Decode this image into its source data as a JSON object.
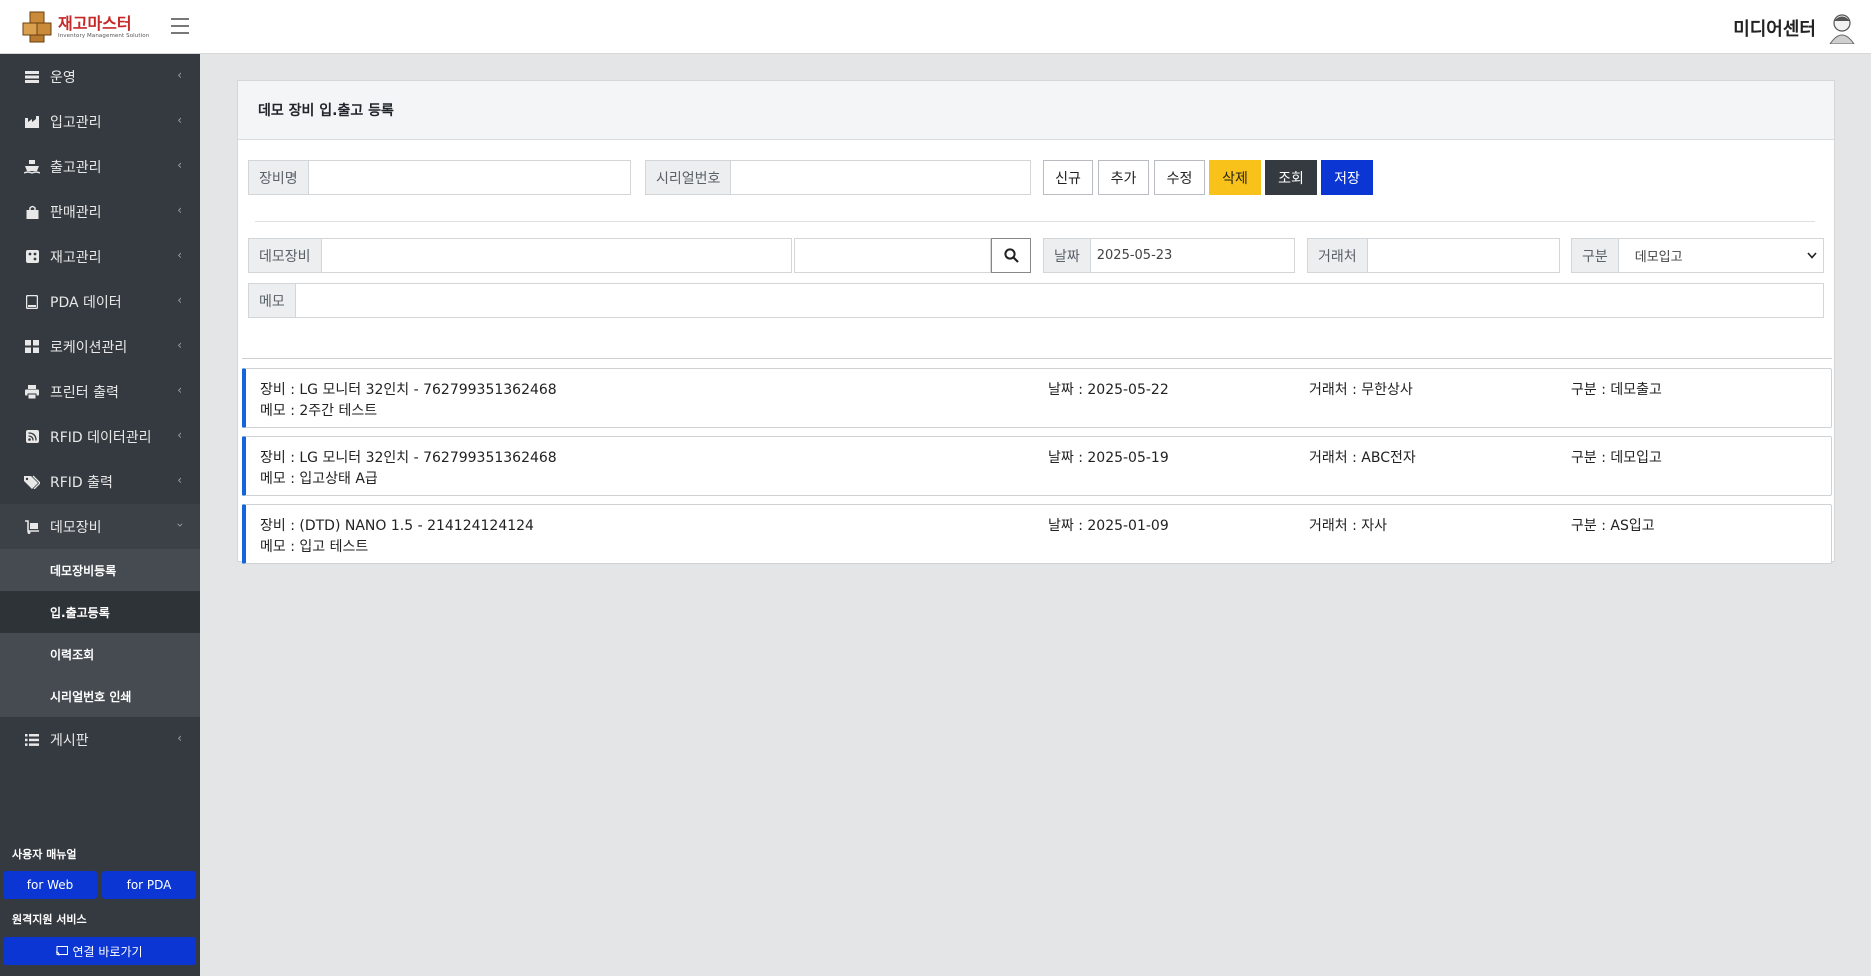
{
  "header": {
    "logo_name": "재고마스터",
    "logo_sub": "Inventory Management Solution",
    "user_name": "미디어센터"
  },
  "sidebar": {
    "items": [
      {
        "label": "운영",
        "icon": "list-icon"
      },
      {
        "label": "입고관리",
        "icon": "factory-icon"
      },
      {
        "label": "출고관리",
        "icon": "ship-icon"
      },
      {
        "label": "판매관리",
        "icon": "shopping-bag-icon"
      },
      {
        "label": "재고관리",
        "icon": "box-icon"
      },
      {
        "label": "PDA 데이터",
        "icon": "tablet-icon"
      },
      {
        "label": "로케이션관리",
        "icon": "grid-icon"
      },
      {
        "label": "프린터 출력",
        "icon": "printer-icon"
      },
      {
        "label": "RFID 데이터관리",
        "icon": "rss-icon"
      },
      {
        "label": "RFID 출력",
        "icon": "tags-icon"
      },
      {
        "label": "데모장비",
        "icon": "dolly-icon"
      }
    ],
    "sub_items": [
      "데모장비등록",
      "입.출고등록",
      "이력조회",
      "시리얼번호 인쇄"
    ],
    "board": {
      "label": "게시판",
      "icon": "list-ul-icon"
    },
    "manual_label": "사용자 매뉴얼",
    "manual_web": "for Web",
    "manual_pda": "for PDA",
    "remote_label": "원격지원 서비스",
    "remote_button": "연결 바로가기"
  },
  "card": {
    "title": "데모 장비 입.출고 등록",
    "equipment_name_label": "장비명",
    "serial_label": "시리얼번호",
    "buttons": {
      "new": "신규",
      "add": "추가",
      "edit": "수정",
      "delete": "삭제",
      "search": "조회",
      "save": "저장"
    },
    "demo_equipment_label": "데모장비",
    "date_label": "날짜",
    "date_value": "2025-05-23",
    "client_label": "거래처",
    "type_label": "구분",
    "type_value": "데모입고",
    "memo_label": "메모"
  },
  "records": [
    {
      "equipment": "장비 : LG 모니터 32인치 - 762799351362468",
      "memo": "메모 : 2주간 테스트",
      "date": "날짜 : 2025-05-22",
      "client": "거래처 : 무한상사",
      "type": "구분 : 데모출고"
    },
    {
      "equipment": "장비 : LG 모니터 32인치 - 762799351362468",
      "memo": "메모 : 입고상태 A급",
      "date": "날짜 : 2025-05-19",
      "client": "거래처 : ABC전자",
      "type": "구분 : 데모입고"
    },
    {
      "equipment": "장비 : (DTD) NANO 1.5 - 214124124124",
      "memo": "메모 : 입고 테스트",
      "date": "날짜 : 2025-01-09",
      "client": "거래처 : 자사",
      "type": "구분 : AS입고"
    }
  ],
  "colors": {
    "accent_blue": "#0b36d3",
    "delete_yellow": "#f8c21a",
    "sidebar_bg": "#343a40",
    "record_accent": "#1464e0"
  }
}
